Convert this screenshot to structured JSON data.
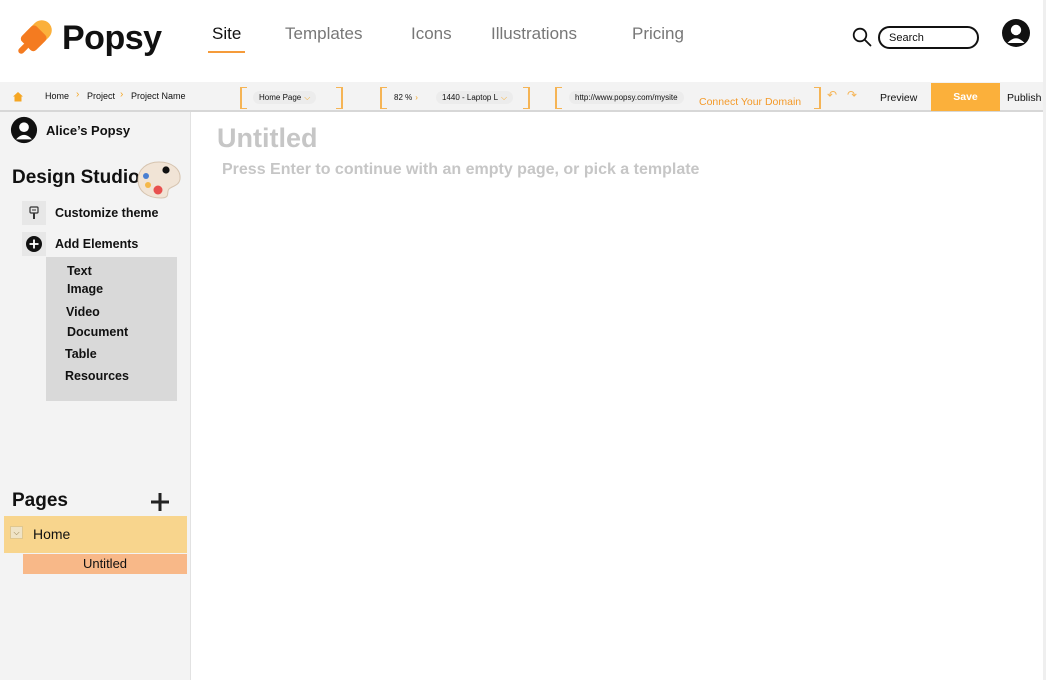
{
  "brand": {
    "name": "Popsy",
    "accent": "#fbb03b",
    "accent_dark": "#f47b20"
  },
  "nav": {
    "links": [
      {
        "label": "Site",
        "active": true
      },
      {
        "label": "Templates",
        "active": false
      },
      {
        "label": "Icons",
        "active": false
      },
      {
        "label": "Illustrations",
        "active": false
      },
      {
        "label": "Pricing",
        "active": false
      }
    ],
    "search_placeholder": "Search",
    "search_icon": "search-icon",
    "profile_icon": "user-avatar-icon"
  },
  "toolbar": {
    "breadcrumb": [
      "Home",
      "Project",
      "Project Name"
    ],
    "page_select": "Home Page",
    "zoom": "82 %",
    "viewport": "1440 - Laptop L",
    "url": "http://www.popsy.com/mysite",
    "connect_domain": "Connect Your Domain",
    "preview": "Preview",
    "save": "Save",
    "publish": "Publish"
  },
  "sidebar": {
    "owner": "Alice’s Popsy",
    "studio_title": "Design Studio",
    "customize": "Customize theme",
    "add_elements": "Add Elements",
    "elements": [
      "Text",
      "Image",
      "Video",
      "Document",
      "Table",
      "Resources"
    ],
    "pages_title": "Pages",
    "pages": [
      {
        "label": "Home",
        "expanded": true
      },
      {
        "label": "Untitled",
        "selected": true
      }
    ]
  },
  "main": {
    "title": "Untitled",
    "hint": "Press Enter to continue with an empty page, or pick a template"
  }
}
